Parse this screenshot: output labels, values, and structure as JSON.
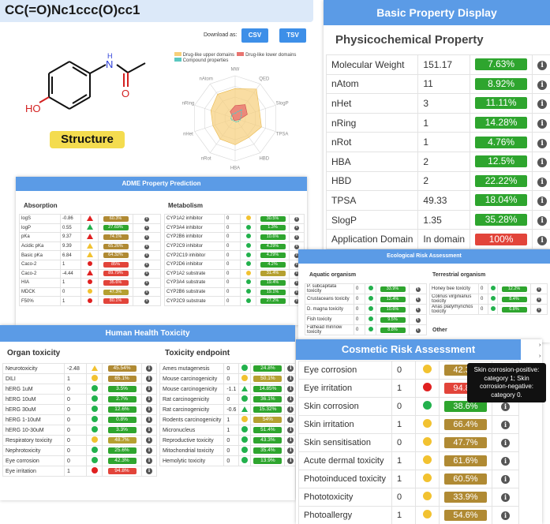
{
  "smiles": "CC(=O)Nc1ccc(O)cc1",
  "download": {
    "label": "Download as:",
    "csv": "CSV",
    "tsv": "TSV"
  },
  "structure_label": "Structure",
  "atoms": {
    "h": "H",
    "n": "N",
    "o": "O",
    "ho": "HO"
  },
  "radar": {
    "legend": [
      "Drug-like upper domains",
      "Drug-like lower domains",
      "Compound properties"
    ],
    "axes": [
      "MW",
      "QED",
      "SlogP",
      "TPSA",
      "HBD",
      "HBA",
      "nRot",
      "nHet",
      "nRing",
      "nAtom"
    ],
    "colors": {
      "upper": "#f6cf7a",
      "lower": "#e87470",
      "compound": "#5ac8c0"
    }
  },
  "adme": {
    "title": "ADME Property Prediction",
    "absorption": {
      "title": "Absorption",
      "rows": [
        {
          "name": "logS",
          "value": "-0.86",
          "mark": "tri-r",
          "pct": "60.3%",
          "color": "pb"
        },
        {
          "name": "logP",
          "value": "0.55",
          "mark": "tri-g",
          "pct": "27.69%",
          "color": "pg"
        },
        {
          "name": "pKa",
          "value": "9.37",
          "mark": "tri-r",
          "pct": "74.1%",
          "color": "pb"
        },
        {
          "name": "Acidic pKa",
          "value": "9.39",
          "mark": "tri-y",
          "pct": "65.26%",
          "color": "pb"
        },
        {
          "name": "Basic pKa",
          "value": "6.84",
          "mark": "tri-y",
          "pct": "64.32%",
          "color": "pb"
        },
        {
          "name": "Caco-2",
          "value": "1",
          "mark": "dot-r",
          "pct": "85%",
          "color": "pr"
        },
        {
          "name": "Caco-2",
          "value": "-4.44",
          "mark": "tri-r",
          "pct": "89.79%",
          "color": "pr"
        },
        {
          "name": "HIA",
          "value": "1",
          "mark": "dot-r",
          "pct": "35.6%",
          "color": "pr"
        },
        {
          "name": "MDCK",
          "value": "0",
          "mark": "dot-y",
          "pct": "47.3%",
          "color": "py"
        },
        {
          "name": "F50%",
          "value": "1",
          "mark": "dot-r",
          "pct": "80.1%",
          "color": "pr"
        }
      ]
    },
    "metabolism": {
      "title": "Metabolism",
      "rows": [
        {
          "name": "CYP1A2 inhibitor",
          "value": "0",
          "mark": "dot-y",
          "pct": "30.5%",
          "color": "pg"
        },
        {
          "name": "CYP3A4 inhibitor",
          "value": "0",
          "mark": "dot-g",
          "pct": "1.3%",
          "color": "pg"
        },
        {
          "name": "CYP2B6 inhibitor",
          "value": "0",
          "mark": "dot-g",
          "pct": "10.6%",
          "color": "pg"
        },
        {
          "name": "CYP2C9 inhibitor",
          "value": "0",
          "mark": "dot-g",
          "pct": "4.29%",
          "color": "pg"
        },
        {
          "name": "CYP2C19 inhibitor",
          "value": "0",
          "mark": "dot-g",
          "pct": "4.29%",
          "color": "pg"
        },
        {
          "name": "CYP2D6 inhibitor",
          "value": "0",
          "mark": "dot-g",
          "pct": "4.2%",
          "color": "pg"
        },
        {
          "name": "CYP1A2 substrate",
          "value": "0",
          "mark": "dot-y",
          "pct": "31.4%",
          "color": "py"
        },
        {
          "name": "CYP3A4 substrate",
          "value": "0",
          "mark": "dot-g",
          "pct": "19.4%",
          "color": "pg"
        },
        {
          "name": "CYP2B6 substrate",
          "value": "0",
          "mark": "dot-g",
          "pct": "19.1%",
          "color": "pg"
        },
        {
          "name": "CYP2C9 substrate",
          "value": "0",
          "mark": "dot-g",
          "pct": "27.2%",
          "color": "pg"
        }
      ]
    }
  },
  "human": {
    "title": "Human Health Toxicity",
    "organ": {
      "title": "Organ toxicity",
      "rows": [
        {
          "name": "Neurotoxicity",
          "value": "-2.48",
          "mark": "tri-y",
          "pct": "45.54%",
          "color": "pb"
        },
        {
          "name": "DILI",
          "value": "1",
          "mark": "dot-y",
          "pct": "65.1%",
          "color": "pb"
        },
        {
          "name": "hERG 1uM",
          "value": "0",
          "mark": "dot-g",
          "pct": "3.5%",
          "color": "pg"
        },
        {
          "name": "hERG 10uM",
          "value": "0",
          "mark": "dot-g",
          "pct": "2.7%",
          "color": "pg"
        },
        {
          "name": "hERG 30uM",
          "value": "0",
          "mark": "dot-g",
          "pct": "12.6%",
          "color": "pg"
        },
        {
          "name": "hERG 1-10uM",
          "value": "0",
          "mark": "dot-g",
          "pct": "0.8%",
          "color": "pg"
        },
        {
          "name": "hERG 10-30uM",
          "value": "0",
          "mark": "dot-g",
          "pct": "3.3%",
          "color": "pg"
        },
        {
          "name": "Respiratory toxicity",
          "value": "0",
          "mark": "dot-y",
          "pct": "48.7%",
          "color": "py"
        },
        {
          "name": "Nephrotoxicity",
          "value": "0",
          "mark": "dot-g",
          "pct": "25.6%",
          "color": "pg"
        },
        {
          "name": "Eye corrosion",
          "value": "0",
          "mark": "dot-g",
          "pct": "42.3%",
          "color": "pg"
        },
        {
          "name": "Eye irritation",
          "value": "1",
          "mark": "dot-r",
          "pct": "94.8%",
          "color": "pr"
        }
      ]
    },
    "endpoint": {
      "title": "Toxicity endpoint",
      "rows": [
        {
          "name": "Ames mutagenesis",
          "value": "0",
          "mark": "dot-g",
          "pct": "24.8%",
          "color": "pg"
        },
        {
          "name": "Mouse carcinogenicity",
          "value": "0",
          "mark": "dot-y",
          "pct": "50.1%",
          "color": "py"
        },
        {
          "name": "Mouse carcinogenicity",
          "value": "-1.1",
          "mark": "tri-g",
          "pct": "14.85%",
          "color": "pg"
        },
        {
          "name": "Rat carcinogenicity",
          "value": "0",
          "mark": "dot-g",
          "pct": "36.1%",
          "color": "pg"
        },
        {
          "name": "Rat carcinogenicity",
          "value": "-0.6",
          "mark": "tri-g",
          "pct": "15.32%",
          "color": "pg"
        },
        {
          "name": "Rodents carcinogenicity",
          "value": "1",
          "mark": "dot-y",
          "pct": "54%",
          "color": "py"
        },
        {
          "name": "Micronucleus",
          "value": "1",
          "mark": "dot-g",
          "pct": "51.4%",
          "color": "pg"
        },
        {
          "name": "Reproductive toxicity",
          "value": "0",
          "mark": "dot-g",
          "pct": "43.3%",
          "color": "pg"
        },
        {
          "name": "Mitochondrial toxicity",
          "value": "0",
          "mark": "dot-g",
          "pct": "35.4%",
          "color": "pg"
        },
        {
          "name": "Hemolytic toxicity",
          "value": "0",
          "mark": "dot-g",
          "pct": "13.9%",
          "color": "pg"
        }
      ]
    }
  },
  "basic": {
    "title": "Basic Property Display",
    "subtitle": "Physicochemical Property",
    "rows": [
      {
        "name": "Molecular Weight",
        "value": "151.17",
        "pct": "7.63%",
        "color": "pg"
      },
      {
        "name": "nAtom",
        "value": "11",
        "pct": "8.92%",
        "color": "pg"
      },
      {
        "name": "nHet",
        "value": "3",
        "pct": "11.11%",
        "color": "pg"
      },
      {
        "name": "nRing",
        "value": "1",
        "pct": "14.28%",
        "color": "pg"
      },
      {
        "name": "nRot",
        "value": "1",
        "pct": "4.76%",
        "color": "pg"
      },
      {
        "name": "HBA",
        "value": "2",
        "pct": "12.5%",
        "color": "pg"
      },
      {
        "name": "HBD",
        "value": "2",
        "pct": "22.22%",
        "color": "pg"
      },
      {
        "name": "TPSA",
        "value": "49.33",
        "pct": "18.04%",
        "color": "pg"
      },
      {
        "name": "SlogP",
        "value": "1.35",
        "pct": "35.28%",
        "color": "pg"
      },
      {
        "name": "Application Domain",
        "value": "In domain",
        "pct": "100%",
        "color": "pr"
      }
    ]
  },
  "eco": {
    "title": "Ecological Risk Assessment",
    "aquatic": {
      "title": "Aquatic organism",
      "rows": [
        {
          "name": "P. subcapitata toxicity",
          "value": "0",
          "mark": "dot-g",
          "pct": "33.9%",
          "color": "pg"
        },
        {
          "name": "Crustaceans toxicity",
          "value": "0",
          "mark": "dot-g",
          "pct": "12.4%",
          "color": "pg"
        },
        {
          "name": "D. magna toxicity",
          "value": "0",
          "mark": "dot-g",
          "pct": "10.6%",
          "color": "pg"
        },
        {
          "name": "Fish toxicity",
          "value": "0",
          "mark": "dot-g",
          "pct": "9.5%",
          "color": "pg"
        },
        {
          "name": "Fathead minnow toxicity",
          "value": "0",
          "mark": "dot-g",
          "pct": "8.8%",
          "color": "pg"
        }
      ]
    },
    "terrestrial": {
      "title": "Terrestrial organism",
      "rows": [
        {
          "name": "Honey bee toxicity",
          "value": "0",
          "mark": "dot-g",
          "pct": "12.2%",
          "color": "pg"
        },
        {
          "name": "Colinus virginianus toxicity",
          "value": "0",
          "mark": "dot-g",
          "pct": "8.4%",
          "color": "pg"
        },
        {
          "name": "Anas platyrhynchos toxicity",
          "value": "0",
          "mark": "dot-g",
          "pct": "6.8%",
          "color": "pg"
        }
      ],
      "other": "Other"
    }
  },
  "cosmetic": {
    "title": "Cosmetic Risk Assessment",
    "tooltip": "Skin corrosion-positive: category 1; Skin corrosion-negative: category 0.",
    "rows": [
      {
        "name": "Eye corrosion",
        "value": "0",
        "mark": "dot-y",
        "pct": "42.3%",
        "color": "pb"
      },
      {
        "name": "Eye irritation",
        "value": "1",
        "mark": "dot-r",
        "pct": "94.8%",
        "color": "pr"
      },
      {
        "name": "Skin corrosion",
        "value": "0",
        "mark": "dot-g",
        "pct": "38.6%",
        "color": "pg"
      },
      {
        "name": "Skin irritation",
        "value": "1",
        "mark": "dot-y",
        "pct": "66.4%",
        "color": "pb"
      },
      {
        "name": "Skin sensitisation",
        "value": "0",
        "mark": "dot-y",
        "pct": "47.7%",
        "color": "pb"
      },
      {
        "name": "Acute dermal toxicity",
        "value": "1",
        "mark": "dot-y",
        "pct": "61.6%",
        "color": "pb"
      },
      {
        "name": "Photoinduced toxicity",
        "value": "1",
        "mark": "dot-y",
        "pct": "60.5%",
        "color": "pb"
      },
      {
        "name": "Phototoxicity",
        "value": "0",
        "mark": "dot-y",
        "pct": "33.9%",
        "color": "pb"
      },
      {
        "name": "Photoallergy",
        "value": "1",
        "mark": "dot-y",
        "pct": "54.6%",
        "color": "pb"
      }
    ]
  }
}
